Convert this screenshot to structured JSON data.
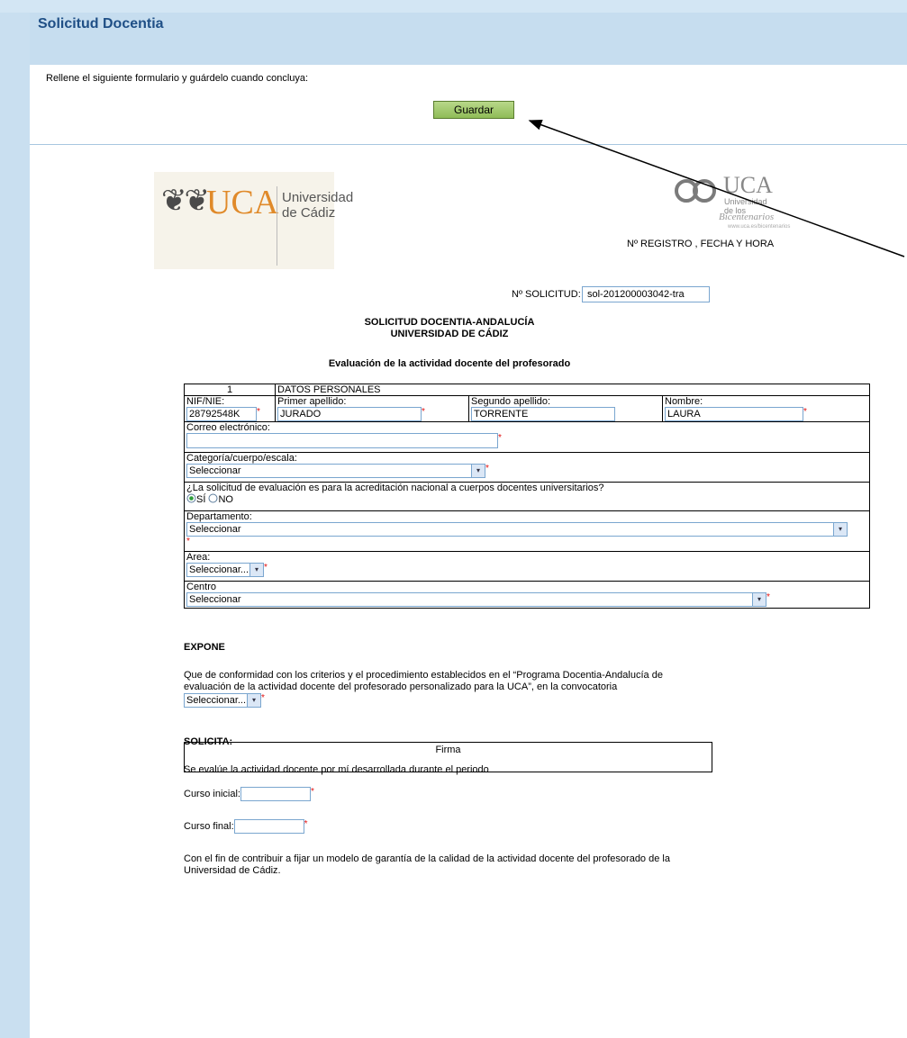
{
  "header": {
    "title": "Solicitud Docentia"
  },
  "panel": {
    "intro": "Rellene el siguiente formulario y guárdelo cuando concluya:",
    "save_label": "Guardar"
  },
  "logos": {
    "left_mark": "UCA",
    "left_univ_line1": "Universidad",
    "left_univ_line2": "de Cádiz",
    "right_mark": "UCA",
    "right_sub1": "Universidad",
    "right_sub2": "de los",
    "right_bic": "Bicentenarios",
    "right_web": "www.uca.es/bicentenarios"
  },
  "registro": {
    "label": "Nº REGISTRO , FECHA Y HORA"
  },
  "solicitud": {
    "label": "Nº SOLICITUD:",
    "value": "sol-201200003042-tra"
  },
  "titles": {
    "line1": "SOLICITUD DOCENTIA-ANDALUCÍA",
    "line2": "UNIVERSIDAD DE CÁDIZ",
    "line3": "Evaluación de la actividad docente del profesorado"
  },
  "datos": {
    "num": "1",
    "heading": "DATOS PERSONALES",
    "nif_label": "NIF/NIE:",
    "nif_value": "28792548K",
    "apellido1_label": "Primer apellido:",
    "apellido1_value": "JURADO",
    "apellido2_label": "Segundo apellido:",
    "apellido2_value": "TORRENTE",
    "nombre_label": "Nombre:",
    "nombre_value": "LAURA",
    "correo_label": "Correo electrónico:",
    "correo_value": "",
    "categoria_label": "Categoría/cuerpo/escala:",
    "categoria_value": "Seleccionar",
    "acreditacion_label": "¿La solicitud de evaluación es para la acreditación nacional a cuerpos docentes universitarios?",
    "radio_si": "SÍ",
    "radio_no": "NO",
    "departamento_label": "Departamento:",
    "departamento_value": "Seleccionar",
    "area_label": "Area:",
    "area_value": "Seleccionar...",
    "centro_label": "Centro",
    "centro_value": "Seleccionar"
  },
  "expone": {
    "heading": "EXPONE",
    "text_line1": "Que de conformidad con los criterios y el procedimiento establecidos en el “Programa Docentia-Andalucía de",
    "text_line2": "evaluación de la actividad docente del profesorado personalizado para la UCA”, en la convocatoria",
    "convocatoria_value": "Seleccionar..."
  },
  "solicita": {
    "heading": "SOLICITA:",
    "text": "Se evalúe la actividad docente por mí desarrollada durante el periodo",
    "curso_inicial_label": "Curso inicial:",
    "curso_final_label": "Curso final:",
    "closing_line1": "Con el fin de contribuir a fijar un modelo de garantía de la calidad de la actividad docente del profesorado de la",
    "closing_line2": "Universidad de Cádiz.",
    "firma_label": "Firma"
  },
  "required_mark": "*",
  "dropdown_arrow": "▾"
}
